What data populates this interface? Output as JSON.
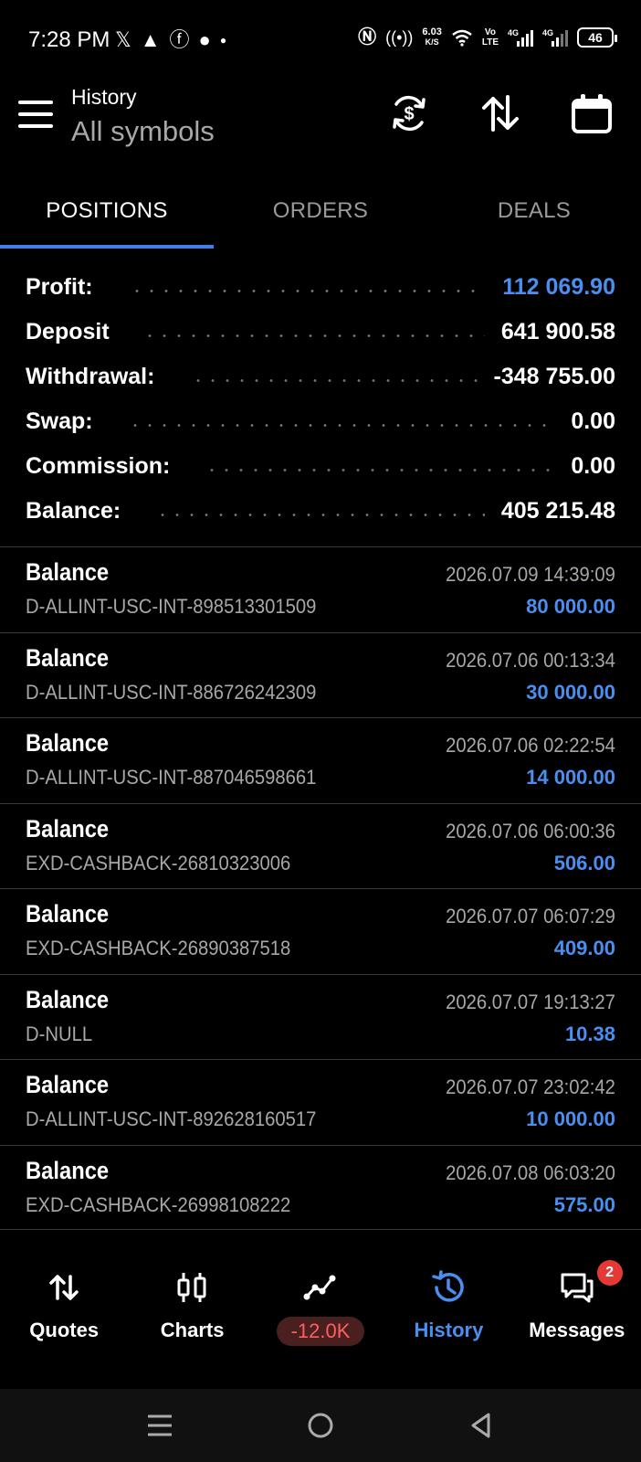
{
  "status_bar": {
    "time": "7:28 PM",
    "left_icons": [
      "x-icon",
      "arrow-icon",
      "facebook-icon",
      "dot-icon"
    ],
    "speed_value": "6.03",
    "speed_unit": "K/S",
    "battery": "46"
  },
  "header": {
    "title": "History",
    "subtitle": "All symbols"
  },
  "tabs": [
    {
      "label": "POSITIONS",
      "active": true
    },
    {
      "label": "ORDERS",
      "active": false
    },
    {
      "label": "DEALS",
      "active": false
    }
  ],
  "summary": [
    {
      "label": "Profit:",
      "value": "112 069.90",
      "color": "#4a8ff0"
    },
    {
      "label": "Deposit",
      "value": "641 900.58"
    },
    {
      "label": "Withdrawal:",
      "value": "-348 755.00"
    },
    {
      "label": "Swap:",
      "value": "0.00"
    },
    {
      "label": "Commission:",
      "value": "0.00"
    },
    {
      "label": "Balance:",
      "value": "405 215.48"
    }
  ],
  "entries": [
    {
      "type": "Balance",
      "comment": "D-ALLINT-USC-INT-898513301509",
      "time": "2026.07.09 14:39:09",
      "amount": "80 000.00"
    },
    {
      "type": "Balance",
      "comment": "D-ALLINT-USC-INT-886726242309",
      "time": "2026.07.06 00:13:34",
      "amount": "30 000.00"
    },
    {
      "type": "Balance",
      "comment": "D-ALLINT-USC-INT-887046598661",
      "time": "2026.07.06 02:22:54",
      "amount": "14 000.00"
    },
    {
      "type": "Balance",
      "comment": "EXD-CASHBACK-26810323006",
      "time": "2026.07.06 06:00:36",
      "amount": "506.00"
    },
    {
      "type": "Balance",
      "comment": "EXD-CASHBACK-26890387518",
      "time": "2026.07.07 06:07:29",
      "amount": "409.00"
    },
    {
      "type": "Balance",
      "comment": "D-NULL",
      "time": "2026.07.07 19:13:27",
      "amount": "10.38"
    },
    {
      "type": "Balance",
      "comment": "D-ALLINT-USC-INT-892628160517",
      "time": "2026.07.07 23:02:42",
      "amount": "10 000.00"
    },
    {
      "type": "Balance",
      "comment": "EXD-CASHBACK-26998108222",
      "time": "2026.07.08 06:03:20",
      "amount": "575.00"
    }
  ],
  "bottom_nav": {
    "quotes": "Quotes",
    "charts": "Charts",
    "trade_pill": "-12.0K",
    "history": "History",
    "messages": "Messages",
    "messages_badge": "2"
  },
  "colors": {
    "accent": "#4a8ff0",
    "tab_indicator": "#3f7fe8",
    "negative": "#ff5e5e",
    "badge": "#e53935"
  }
}
